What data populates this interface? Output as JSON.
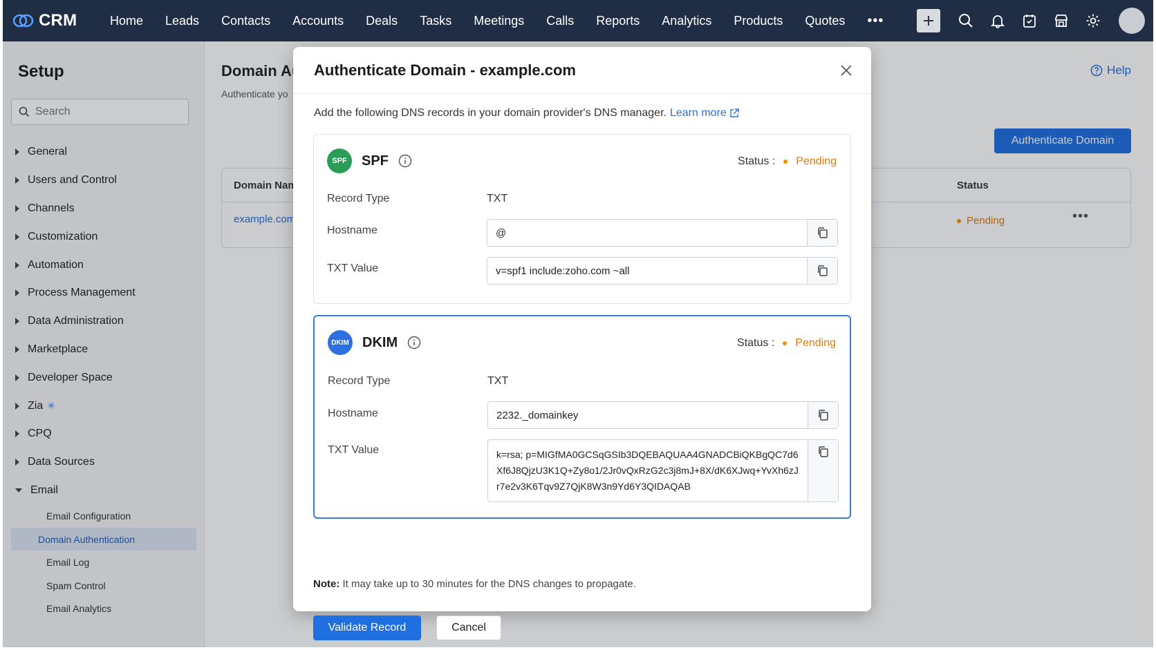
{
  "nav": {
    "brand": "CRM",
    "items": [
      "Home",
      "Leads",
      "Contacts",
      "Accounts",
      "Deals",
      "Tasks",
      "Meetings",
      "Calls",
      "Reports",
      "Analytics",
      "Products",
      "Quotes"
    ],
    "more": "•••",
    "icons": [
      "plus-icon",
      "search-icon",
      "bell-icon",
      "calendar-icon",
      "store-icon",
      "gear-icon"
    ]
  },
  "sidebar": {
    "title": "Setup",
    "search_placeholder": "Search",
    "items": [
      "General",
      "Users and Control",
      "Channels",
      "Customization",
      "Automation",
      "Process Management",
      "Data Administration",
      "Marketplace",
      "Developer Space",
      "Zia",
      "CPQ",
      "Data Sources",
      "Email"
    ],
    "email_subitems": [
      "Email Configuration",
      "Domain Authentication",
      "Email Log",
      "Spam Control",
      "Email Analytics"
    ],
    "active_subitem": "Domain Authentication"
  },
  "main": {
    "title": "Domain Au",
    "subtitle": "Authenticate yo",
    "help": "Help",
    "authenticate_button": "Authenticate Domain",
    "table": {
      "col_domain": "Domain Nam",
      "col_status": "Status",
      "row_domain": "example.com",
      "row_status": "Pending",
      "row_more": "•••"
    }
  },
  "modal": {
    "title": "Authenticate Domain - example.com",
    "description": "Add the following DNS records in your domain provider's DNS manager.",
    "learn_more": "Learn more",
    "spf": {
      "badge": "SPF",
      "name": "SPF",
      "status_label": "Status :",
      "status_value": "Pending",
      "record_type_label": "Record Type",
      "record_type_value": "TXT",
      "hostname_label": "Hostname",
      "hostname_value": "@",
      "txt_label": "TXT Value",
      "txt_value": "v=spf1 include:zoho.com ~all"
    },
    "dkim": {
      "badge": "DKIM",
      "name": "DKIM",
      "status_label": "Status :",
      "status_value": "Pending",
      "record_type_label": "Record Type",
      "record_type_value": "TXT",
      "hostname_label": "Hostname",
      "hostname_value": "2232._domainkey",
      "txt_label": "TXT Value",
      "txt_value": "k=rsa; p=MIGfMA0GCSqGSIb3DQEBAQUAA4GNADCBiQKBgQC7d6Xf6J8QjzU3K1Q+Zy8o1/2Jr0vQxRzG2c3j8mJ+8X/dK6XJwq+YvXh6zJr7e2v3K6Tqv9Z7QjK8W3n9Yd6Y3QIDAQAB"
    },
    "note_prefix": "Note:",
    "note_text": " It may take up to 30 minutes for the DNS changes to propagate.",
    "validate_button": "Validate Record",
    "cancel_button": "Cancel"
  }
}
